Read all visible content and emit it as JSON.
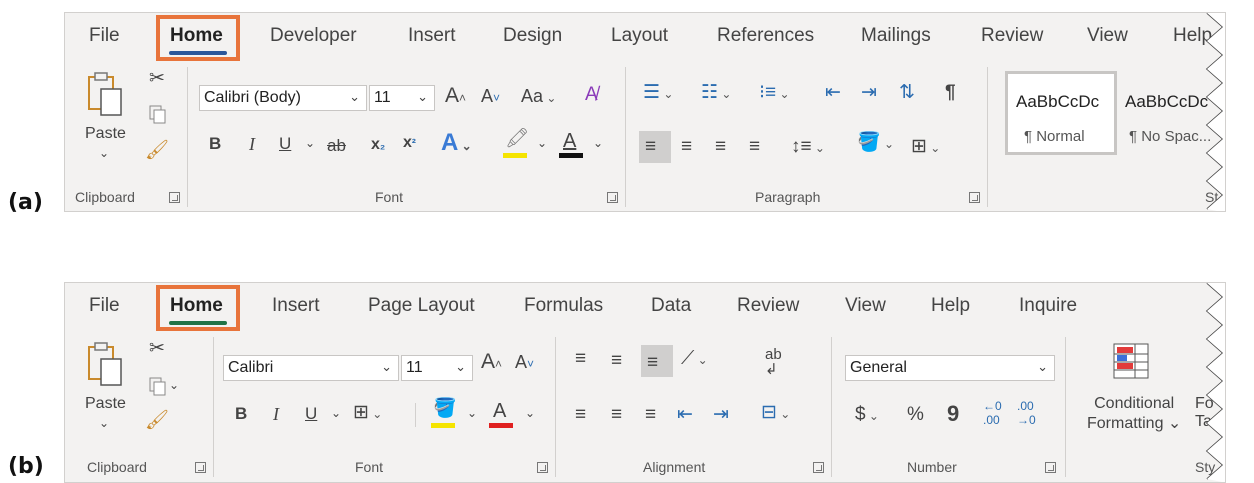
{
  "panels": [
    {
      "label": "(a)",
      "app": "Word",
      "tabs": [
        "File",
        "Home",
        "Developer",
        "Insert",
        "Design",
        "Layout",
        "References",
        "Mailings",
        "Review",
        "View",
        "Help"
      ],
      "active_tab": "Home",
      "underline_color": "#2b579a",
      "highlight_color": "#e8743b",
      "groups": {
        "clipboard": "Clipboard",
        "font": "Font",
        "paragraph": "Paragraph",
        "styles": "St"
      },
      "clipboard": {
        "paste": "Paste"
      },
      "font": {
        "name": "Calibri (Body)",
        "size": "11",
        "grow": "A",
        "shrink": "A",
        "change_case": "Aa",
        "bold": "B",
        "italic": "I",
        "underline": "U",
        "strike": "ab",
        "subscript": "x",
        "superscript": "x",
        "text_effects": "A",
        "highlight_color": "#f5e400",
        "font_color": "#111111",
        "font_color_letter": "A"
      },
      "styles": [
        {
          "preview": "AaBbCcDc",
          "name": "¶ Normal"
        },
        {
          "preview": "AaBbCcDc",
          "name": "¶ No Spac..."
        }
      ]
    },
    {
      "label": "(b)",
      "app": "Excel",
      "tabs": [
        "File",
        "Home",
        "Insert",
        "Page Layout",
        "Formulas",
        "Data",
        "Review",
        "View",
        "Help",
        "Inquire"
      ],
      "active_tab": "Home",
      "underline_color": "#217346",
      "highlight_color": "#e8743b",
      "groups": {
        "clipboard": "Clipboard",
        "font": "Font",
        "alignment": "Alignment",
        "number": "Number",
        "styles": "Sty"
      },
      "clipboard": {
        "paste": "Paste"
      },
      "font": {
        "name": "Calibri",
        "size": "11",
        "grow": "A",
        "shrink": "A",
        "bold": "B",
        "italic": "I",
        "underline": "U",
        "fill_color": "#f5e400",
        "font_color": "#e02020",
        "font_color_letter": "A"
      },
      "number": {
        "format": "General",
        "currency": "$",
        "percent": "%",
        "comma": "9",
        "increase_decimal_top": "←0",
        "increase_decimal_bottom": ".00",
        "decrease_decimal_top": ".00",
        "decrease_decimal_bottom": "→0"
      },
      "conditional": {
        "line1": "Conditional",
        "line2": "Formatting"
      },
      "format_as_table": {
        "line1": "Fo",
        "line2": "Ta"
      }
    }
  ]
}
